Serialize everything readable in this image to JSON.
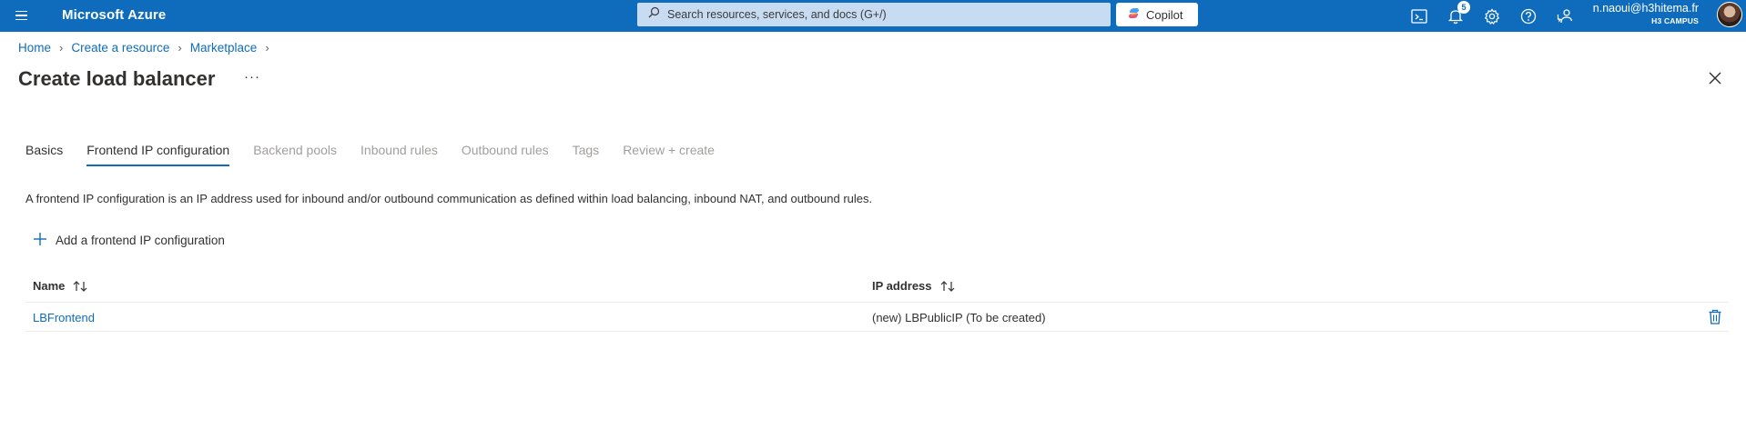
{
  "topbar": {
    "brand": "Microsoft Azure",
    "search_placeholder": "Search resources, services, and docs (G+/)",
    "copilot_label": "Copilot",
    "notification_count": "5",
    "account_email": "n.naoui@h3hitema.fr",
    "account_tenant": "H3 CAMPUS",
    "icons": [
      "menu-icon",
      "cloud-shell-icon",
      "notifications-icon",
      "settings-icon",
      "help-icon",
      "feedback-icon"
    ],
    "colors": {
      "bar": "#0f6cbd",
      "search_bg": "#c7dcf3"
    }
  },
  "breadcrumb": {
    "items": [
      "Home",
      "Create a resource",
      "Marketplace"
    ]
  },
  "page": {
    "title": "Create load balancer",
    "more_label": "···"
  },
  "tabs": [
    {
      "label": "Basics",
      "state": "enabled"
    },
    {
      "label": "Frontend IP configuration",
      "state": "active"
    },
    {
      "label": "Backend pools",
      "state": "disabled"
    },
    {
      "label": "Inbound rules",
      "state": "disabled"
    },
    {
      "label": "Outbound rules",
      "state": "disabled"
    },
    {
      "label": "Tags",
      "state": "disabled"
    },
    {
      "label": "Review + create",
      "state": "disabled"
    }
  ],
  "description": "A frontend IP configuration is an IP address used for inbound and/or outbound communication as defined within load balancing, inbound NAT, and outbound rules.",
  "add_button_label": "Add a frontend IP configuration",
  "table": {
    "columns": [
      "Name",
      "IP address"
    ],
    "rows": [
      {
        "name": "LBFrontend",
        "ip": "(new) LBPublicIP (To be created)"
      }
    ]
  },
  "accent_color": "#0f6cbd"
}
